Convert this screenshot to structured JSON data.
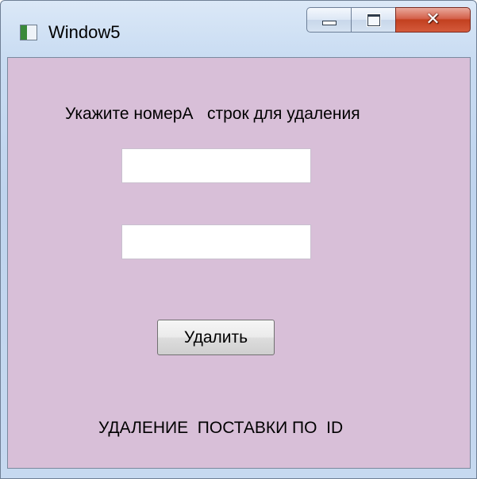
{
  "window": {
    "title": "Window5",
    "controls": {
      "minimize": "minimize-icon",
      "maximize": "maximize-icon",
      "close": "close-icon"
    }
  },
  "form": {
    "instruction": "Укажите номерА   строк для удаления",
    "field_1": {
      "value": "",
      "placeholder": ""
    },
    "field_2": {
      "value": "",
      "placeholder": ""
    },
    "delete_button_label": "Удалить",
    "caption": "УДАЛЕНИЕ  ПОСТАВКИ ПО  ID"
  },
  "colors": {
    "client_background": "#d8bfd8",
    "frame_background": "#c6d9f0",
    "close_button": "#c2401f"
  }
}
